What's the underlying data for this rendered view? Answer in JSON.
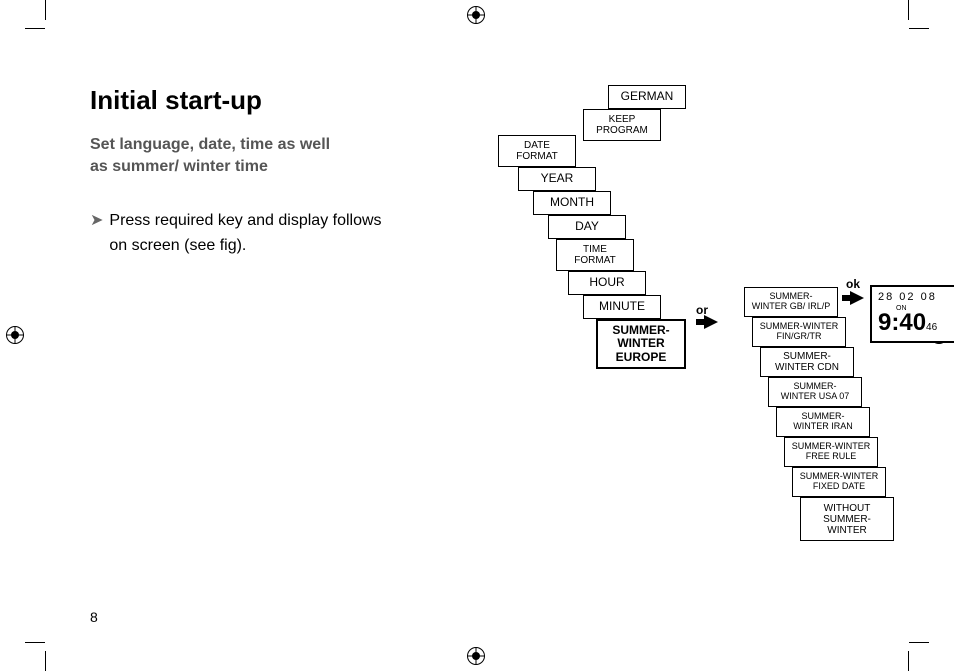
{
  "page": {
    "title": "Initial start-up",
    "subtitle_line1": "Set language, date, time as well",
    "subtitle_line2": "as summer/ winter time",
    "instruction_bullet": "➤",
    "instruction_line1": "Press required key and display follows",
    "instruction_line2": "on screen (see fig).",
    "page_number": "8"
  },
  "menu_stack": {
    "german": "GERMAN",
    "keep_program_l1": "KEEP",
    "keep_program_l2": "PROGRAM",
    "date_format_l1": "DATE",
    "date_format_l2": "FORMAT",
    "year": "YEAR",
    "month": "MONTH",
    "day": "DAY",
    "time_format_l1": "TIME",
    "time_format_l2": "FORMAT",
    "hour": "HOUR",
    "minute": "MINUTE",
    "summer_winter_l1": "SUMMER-",
    "summer_winter_l2": "WINTER",
    "summer_winter_l3": "EUROPE"
  },
  "connectors": {
    "or": "or",
    "ok": "ok"
  },
  "region_stack": {
    "gb_l1": "SUMMER-",
    "gb_l2": "WINTER GB/ IRL/P",
    "fin_l1": "SUMMER-WINTER",
    "fin_l2": "FIN/GR/TR",
    "cdn_l1": "SUMMER-",
    "cdn_l2": "WINTER CDN",
    "usa_l1": "SUMMER-",
    "usa_l2": "WINTER USA 07",
    "iran_l1": "SUMMER-",
    "iran_l2": "WINTER IRAN",
    "free_l1": "SUMMER-WINTER",
    "free_l2": "FREE RULE",
    "fixed_l1": "SUMMER-WINTER",
    "fixed_l2": "FIXED DATE",
    "without_l1": "WITHOUT",
    "without_l2": "SUMMER-",
    "without_l3": "WINTER"
  },
  "display": {
    "date": "28   02   08",
    "on": "ON",
    "time": "9:40",
    "seconds": "46"
  }
}
